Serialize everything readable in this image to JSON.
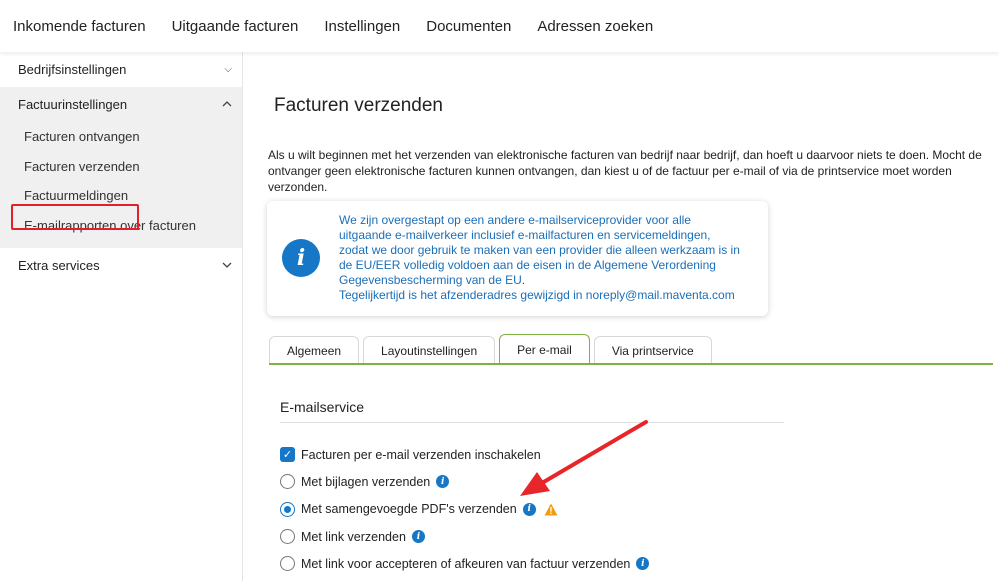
{
  "topnav": {
    "items": [
      "Inkomende facturen",
      "Uitgaande facturen",
      "Instellingen",
      "Documenten",
      "Adressen zoeken"
    ]
  },
  "sidebar": {
    "bedrijfsinstellingen": "Bedrijfsinstellingen",
    "factuurinstellingen": "Factuurinstellingen",
    "sub": [
      "Facturen ontvangen",
      "Facturen verzenden",
      "Factuurmeldingen",
      "E-mailrapporten over facturen"
    ],
    "extra_services": "Extra services"
  },
  "main": {
    "title": "Facturen verzenden",
    "intro": "Als u wilt beginnen met het verzenden van elektronische facturen van bedrijf naar bedrijf, dan hoeft u daarvoor niets te doen. Mocht de ontvanger geen elektronische facturen kunnen ontvangen, dan kiest u of de factuur per e-mail of via de printservice moet worden verzonden.",
    "info_lines": [
      "We zijn overgestapt op een andere e-mailserviceprovider voor alle",
      "uitgaande e-mailverkeer inclusief e-mailfacturen en servicemeldingen,",
      "zodat we door gebruik te maken van een provider die alleen werkzaam is in",
      "de EU/EER volledig voldoen aan de eisen in de Algemene Verordening",
      "Gegevensbescherming van de EU.",
      "Tegelijkertijd is het afzenderadres gewijzigd in noreply@mail.maventa.com"
    ],
    "tabs": [
      "Algemeen",
      "Layoutinstellingen",
      "Per e-mail",
      "Via printservice"
    ],
    "active_tab": "Per e-mail",
    "section_title": "E-mailservice",
    "options": {
      "enable": "Facturen per e-mail verzenden inschakelen",
      "attachments": "Met bijlagen verzenden",
      "merged_pdf": "Met samengevoegde PDF's verzenden",
      "link": "Met link verzenden",
      "link_accept": "Met link voor accepteren of afkeuren van factuur verzenden"
    },
    "selected_option": "merged_pdf"
  },
  "colors": {
    "accent": "#1577c5",
    "tab_active": "#7cb342",
    "highlight_box": "#e0202a",
    "warning": "#f39c12",
    "arrow": "#e8262a"
  },
  "icons": {
    "info": "info-icon",
    "warning": "warning-icon",
    "chevron": "chevron-down-icon"
  }
}
